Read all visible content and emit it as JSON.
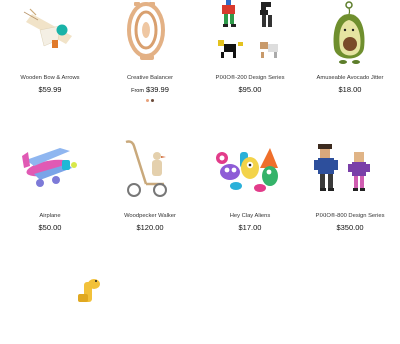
{
  "products": [
    {
      "name": "Wooden Bow & Arrows",
      "price": "$59.99",
      "image": "bow-arrows-image"
    },
    {
      "name": "Creative Balancer",
      "from_label": "From",
      "price": "$39.99",
      "image": "balancer-image",
      "swatches": [
        "#e8a17a",
        "#6b4b3a"
      ]
    },
    {
      "name": "PIXIO®-200 Design Series",
      "price": "$95.00",
      "image": "pixio-200-image"
    },
    {
      "name": "Amuseable Avocado Jitter",
      "price": "$18.00",
      "image": "avocado-plush-image"
    },
    {
      "name": "Airplane",
      "price": "$50.00",
      "image": "airplane-image"
    },
    {
      "name": "Woodpecker Walker",
      "price": "$120.00",
      "image": "walker-image"
    },
    {
      "name": "Hey Clay Aliens",
      "price": "$17.00",
      "image": "clay-aliens-image"
    },
    {
      "name": "PIXIO®-800 Design Series",
      "price": "$350.00",
      "image": "pixio-800-image"
    },
    {
      "name": "",
      "price": "",
      "image": "giraffe-image"
    }
  ]
}
